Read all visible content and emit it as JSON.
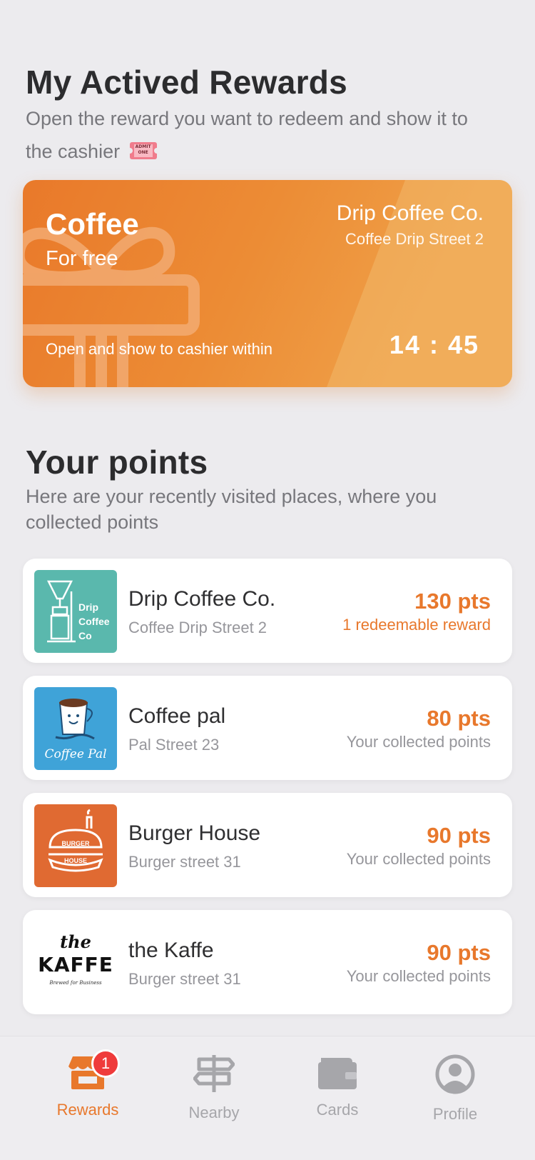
{
  "rewards_section": {
    "title": "My Actived Rewards",
    "subtitle": "Open the reward you want to redeem and show it to the cashier",
    "ticket_text": "ADMIT ONE"
  },
  "reward": {
    "title": "Coffee",
    "subtitle": "For free",
    "vendor": "Drip Coffee Co.",
    "address": "Coffee Drip Street 2",
    "hint": "Open and show to cashier within",
    "timer": "14 : 45"
  },
  "points_section": {
    "title": "Your points",
    "subtitle": "Here are your recently visited places, where you collected points"
  },
  "places": [
    {
      "name": "Drip Coffee Co.",
      "address": "Coffee Drip Street 2",
      "points": "130 pts",
      "note": "1 redeemable reward",
      "logo_text": [
        "Drip",
        "Coffee",
        "Co"
      ]
    },
    {
      "name": "Coffee pal",
      "address": "Pal Street 23",
      "points": "80 pts",
      "note": "Your collected points",
      "logo_text": "Coffee Pal"
    },
    {
      "name": "Burger House",
      "address": "Burger street 31",
      "points": "90 pts",
      "note": "Your collected points",
      "logo_text": [
        "BURGER",
        "HOUSE"
      ]
    },
    {
      "name": "the Kaffe",
      "address": "Burger street 31",
      "points": "90 pts",
      "note": "Your collected points",
      "logo_text": [
        "the",
        "KAFFE",
        "Brewed for Business"
      ]
    }
  ],
  "tabbar": {
    "items": [
      {
        "label": "Rewards",
        "icon": "store-icon",
        "active": true,
        "badge": "1"
      },
      {
        "label": "Nearby",
        "icon": "signpost-icon",
        "active": false
      },
      {
        "label": "Cards",
        "icon": "wallet-icon",
        "active": false
      },
      {
        "label": "Profile",
        "icon": "profile-icon",
        "active": false
      }
    ]
  },
  "colors": {
    "accent": "#e8782c",
    "badge": "#ef3b3b",
    "background": "#ecebee"
  }
}
